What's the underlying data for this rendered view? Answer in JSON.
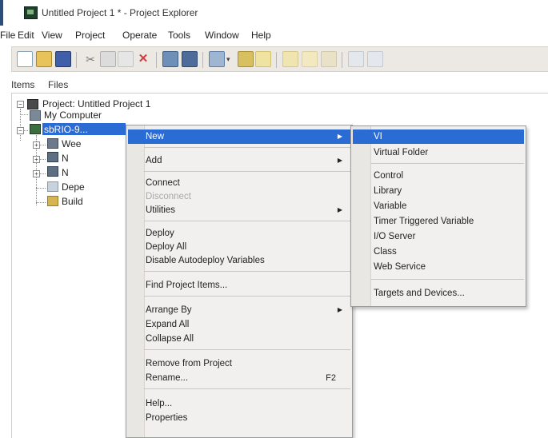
{
  "window": {
    "title": "Untitled Project 1 * - Project Explorer"
  },
  "menu": [
    "File",
    "Edit",
    "View",
    "Project",
    "Operate",
    "Tools",
    "Window",
    "Help"
  ],
  "tabs": [
    "Items",
    "Files"
  ],
  "tree": {
    "project": "Project: Untitled Project 1",
    "my_computer": "My Computer",
    "target": "sbRIO-9...",
    "child1": "Wee",
    "child2": "N",
    "child3": "N",
    "deps": "Depe",
    "build": "Build"
  },
  "context_menu": {
    "items": [
      {
        "label": "New",
        "submenu": true,
        "highlight": true
      },
      {
        "label": "Add",
        "submenu": true
      },
      {
        "label": "Connect"
      },
      {
        "label": "Disconnect",
        "disabled": true
      },
      {
        "label": "Utilities",
        "submenu": true
      },
      {
        "label": "Deploy"
      },
      {
        "label": "Deploy All"
      },
      {
        "label": "Disable Autodeploy Variables"
      },
      {
        "label": "Find Project Items..."
      },
      {
        "label": "Arrange By",
        "submenu": true
      },
      {
        "label": "Expand All"
      },
      {
        "label": "Collapse All"
      },
      {
        "label": "Remove from Project"
      },
      {
        "label": "Rename...",
        "shortcut": "F2"
      },
      {
        "label": "Help..."
      },
      {
        "label": "Properties"
      }
    ]
  },
  "submenu": {
    "items": [
      "VI",
      "Virtual Folder",
      "Control",
      "Library",
      "Variable",
      "Timer Triggered Variable",
      "I/O Server",
      "Class",
      "Web Service",
      "Targets and Devices..."
    ]
  },
  "colors": {
    "highlight": "#2b6cd4",
    "menu_bg": "#f1f0ee"
  }
}
